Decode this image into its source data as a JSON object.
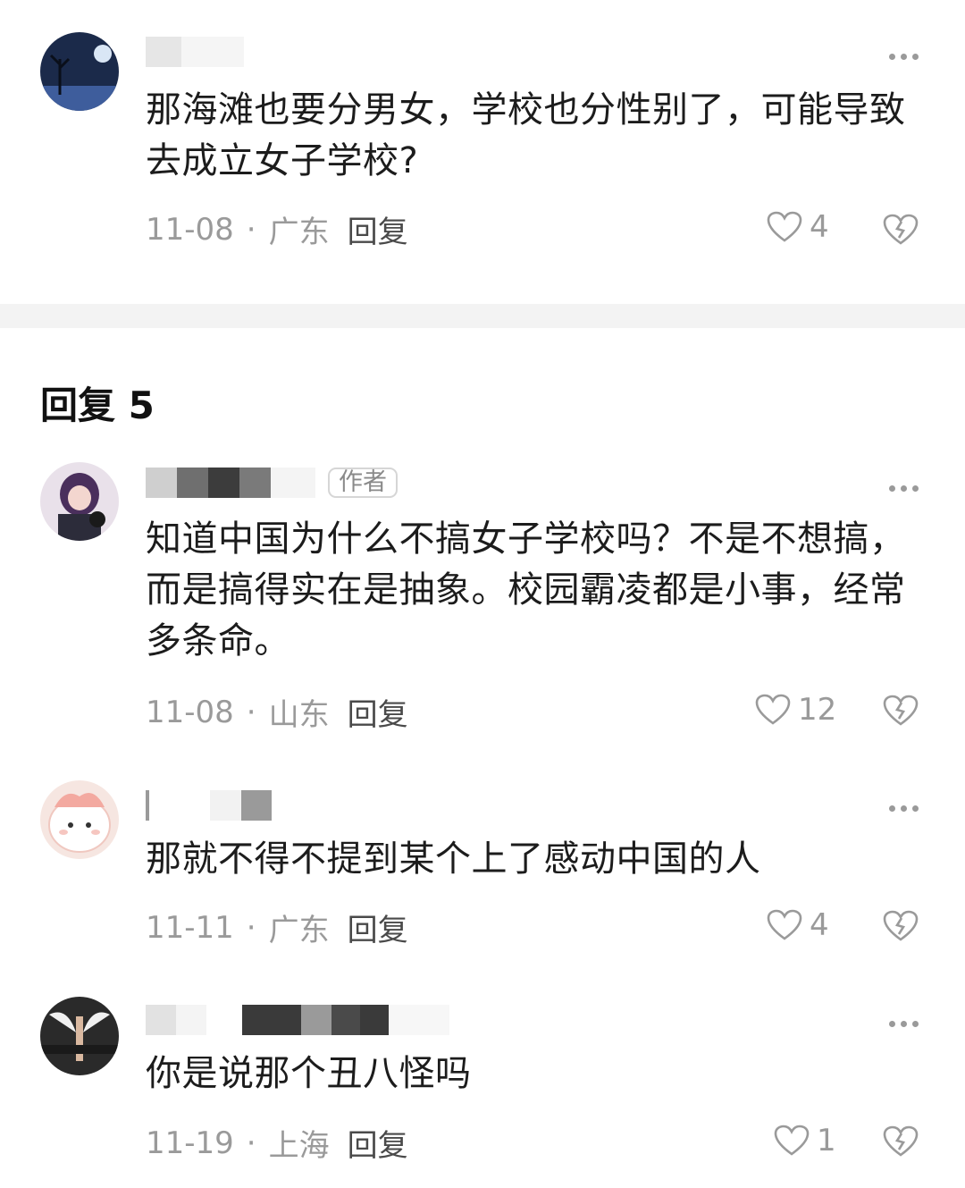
{
  "section": {
    "title": "回复 5"
  },
  "comments": [
    {
      "text": "那海滩也要分男女，学校也分性别了，可能导致去成立女子学校?",
      "date": "11-08",
      "location": "广东",
      "reply_label": "回复",
      "likes": "4"
    },
    {
      "author_tag": "作者",
      "text": "知道中国为什么不搞女子学校吗？不是不想搞，而是搞得实在是抽象。校园霸凌都是小事，经常多条命。",
      "date": "11-08",
      "location": "山东",
      "reply_label": "回复",
      "likes": "12"
    },
    {
      "text": "那就不得不提到某个上了感动中国的人",
      "date": "11-11",
      "location": "广东",
      "reply_label": "回复",
      "likes": "4"
    },
    {
      "text": "你是说那个丑八怪吗",
      "date": "11-19",
      "location": "上海",
      "reply_label": "回复",
      "likes": "1"
    }
  ],
  "separator": "·",
  "icons": {
    "more": "more-dots-icon",
    "like": "heart-outline-icon",
    "dislike": "broken-heart-icon"
  },
  "colors": {
    "text": "#1c1c1c",
    "meta": "#9a9a9a",
    "divider": "#f3f3f3"
  }
}
